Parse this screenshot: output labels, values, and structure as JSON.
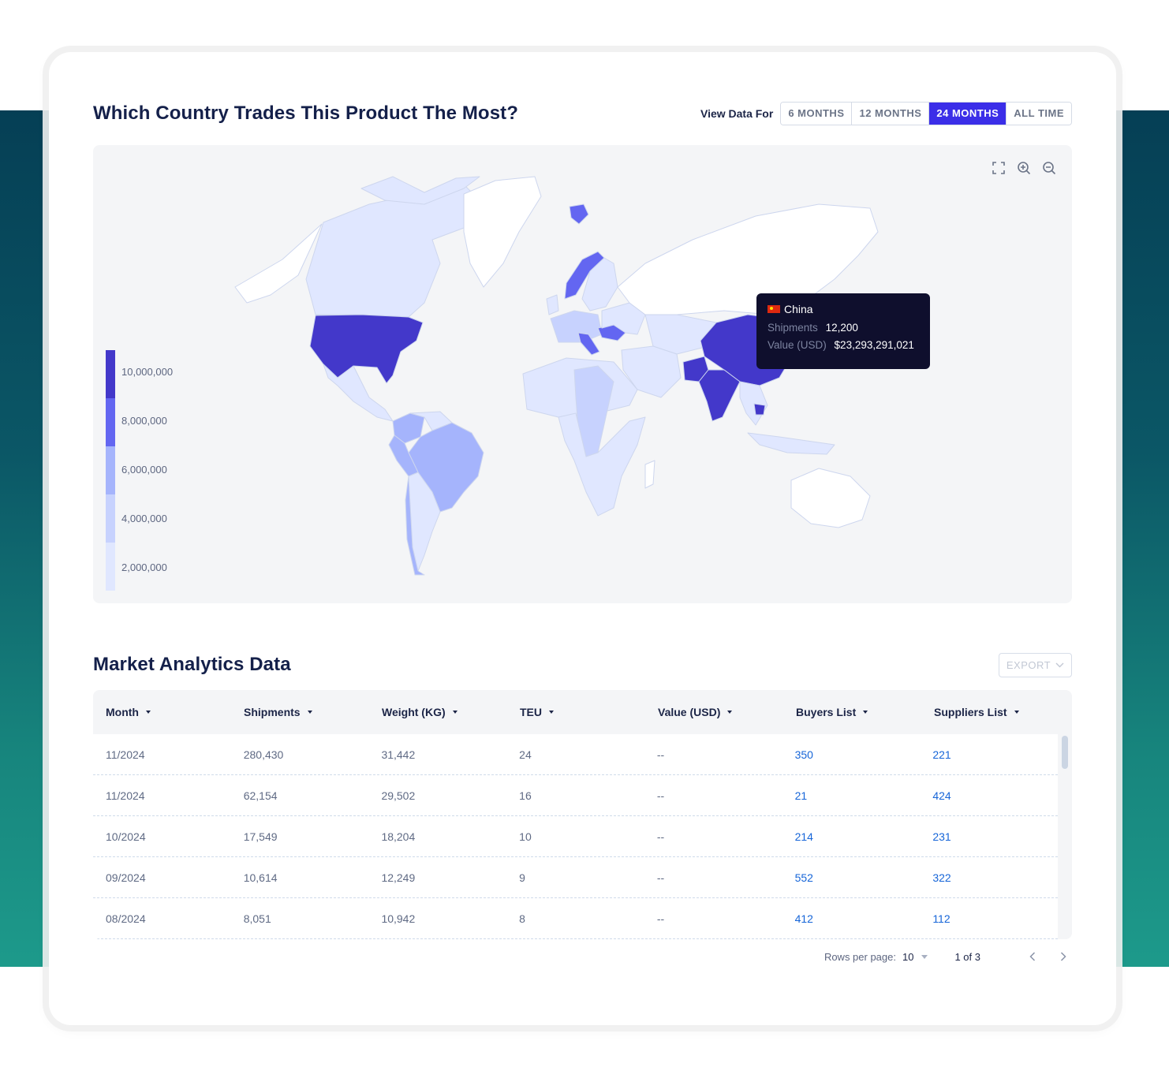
{
  "map_section": {
    "title": "Which Country Trades This Product The Most?",
    "view_label": "View Data For",
    "ranges": [
      {
        "label": "6 MONTHS",
        "active": false
      },
      {
        "label": "12 MONTHS",
        "active": false
      },
      {
        "label": "24 MONTHS",
        "active": true
      },
      {
        "label": "ALL TIME",
        "active": false
      }
    ],
    "tools": [
      "fullscreen-icon",
      "zoom-in-icon",
      "zoom-out-icon"
    ],
    "legend": {
      "labels": [
        "10,000,000",
        "8,000,000",
        "6,000,000",
        "4,000,000",
        "2,000,000"
      ],
      "colors": [
        "#4338ca",
        "#6366f1",
        "#a5b4fc",
        "#c7d2fe",
        "#e0e7ff"
      ]
    },
    "tooltip": {
      "country": "China",
      "shipments_label": "Shipments",
      "shipments_value": "12,200",
      "value_label": "Value (USD)",
      "value_value": "$23,293,291,021"
    },
    "highlighted_countries": {
      "highest": [
        "United States",
        "China",
        "India",
        "Pakistan",
        "Cambodia"
      ],
      "high": [
        "Norway",
        "Svalbard",
        "Italy",
        "Hungary",
        "Romania"
      ],
      "medium": [
        "Brazil",
        "Peru",
        "Ecuador",
        "Colombia",
        "Chile",
        "France",
        "Germany",
        "Sudan",
        "DR Congo"
      ]
    }
  },
  "table_section": {
    "title": "Market Analytics Data",
    "export_label": "EXPORT",
    "columns": [
      "Month",
      "Shipments",
      "Weight (KG)",
      "TEU",
      "Value (USD)",
      "Buyers List",
      "Suppliers List"
    ],
    "rows": [
      {
        "month": "11/2024",
        "shipments": "280,430",
        "weight": "31,442",
        "teu": "24",
        "value": "--",
        "buyers": "350",
        "suppliers": "221"
      },
      {
        "month": "11/2024",
        "shipments": "62,154",
        "weight": "29,502",
        "teu": "16",
        "value": "--",
        "buyers": "21",
        "suppliers": "424"
      },
      {
        "month": "10/2024",
        "shipments": "17,549",
        "weight": "18,204",
        "teu": "10",
        "value": "--",
        "buyers": "214",
        "suppliers": "231"
      },
      {
        "month": "09/2024",
        "shipments": "10,614",
        "weight": "12,249",
        "teu": "9",
        "value": "--",
        "buyers": "552",
        "suppliers": "322"
      },
      {
        "month": "08/2024",
        "shipments": "8,051",
        "weight": "10,942",
        "teu": "8",
        "value": "--",
        "buyers": "412",
        "suppliers": "112"
      }
    ],
    "pagination": {
      "rows_per_page_label": "Rows per page:",
      "rows_per_page_value": "10",
      "page_info": "1 of 3"
    }
  },
  "colors": {
    "accent": "#3b2ee8",
    "link": "#1665d8",
    "title": "#14204a",
    "tooltip_bg": "#0f0f2d"
  }
}
